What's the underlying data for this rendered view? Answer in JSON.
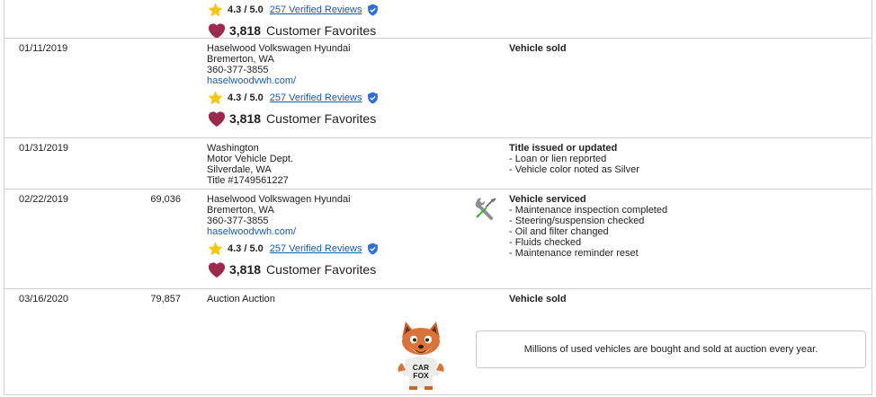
{
  "rows": [
    {
      "date": "",
      "odometer": "",
      "source": {
        "lines": [],
        "link": ""
      },
      "rating": {
        "score": "4.3 / 5.0",
        "reviews": "257 Verified Reviews"
      },
      "favorites": {
        "count": "3,818",
        "label": "Customer Favorites"
      },
      "comments": {
        "head": "",
        "items": []
      }
    },
    {
      "date": "01/11/2019",
      "odometer": "",
      "source": {
        "lines": [
          "Haselwood Volkswagen Hyundai",
          "Bremerton, WA",
          "360-377-3855"
        ],
        "link": "haselwoodvwh.com/"
      },
      "rating": {
        "score": "4.3 / 5.0",
        "reviews": "257 Verified Reviews"
      },
      "favorites": {
        "count": "3,818",
        "label": "Customer Favorites"
      },
      "comments": {
        "head": "Vehicle sold",
        "items": []
      }
    },
    {
      "date": "01/31/2019",
      "odometer": "",
      "source": {
        "lines": [
          "Washington",
          "Motor Vehicle Dept.",
          "Silverdale, WA",
          "Title #1749561227"
        ],
        "link": ""
      },
      "comments": {
        "head": "Title issued or updated",
        "items": [
          "- Loan or lien reported",
          "- Vehicle color noted as Silver"
        ]
      }
    },
    {
      "date": "02/22/2019",
      "odometer": "69,036",
      "source": {
        "lines": [
          "Haselwood Volkswagen Hyundai",
          "Bremerton, WA",
          "360-377-3855"
        ],
        "link": "haselwoodvwh.com/"
      },
      "rating": {
        "score": "4.3 / 5.0",
        "reviews": "257 Verified Reviews"
      },
      "favorites": {
        "count": "3,818",
        "label": "Customer Favorites"
      },
      "icon": "wrench-screwdriver-icon",
      "comments": {
        "head": "Vehicle serviced",
        "items": [
          "- Maintenance inspection completed",
          "- Steering/suspension checked",
          "- Oil and filter changed",
          "- Fluids checked",
          "- Maintenance reminder reset"
        ]
      }
    },
    {
      "date": "03/16/2020",
      "odometer": "79,857",
      "source": {
        "lines": [
          "Auction Auction"
        ],
        "link": ""
      },
      "comments": {
        "head": "Vehicle sold",
        "items": []
      },
      "auction_note": "Millions of used vehicles are bought and sold at auction every year.",
      "mascot": {
        "shirt_line1": "CAR",
        "shirt_line2": "FOX"
      }
    }
  ],
  "colors": {
    "link": "#1a5ba6",
    "star": "#f5c518",
    "heart": "#9b2a4c",
    "check": "#2f6fd6",
    "border": "#d0d0d0"
  }
}
